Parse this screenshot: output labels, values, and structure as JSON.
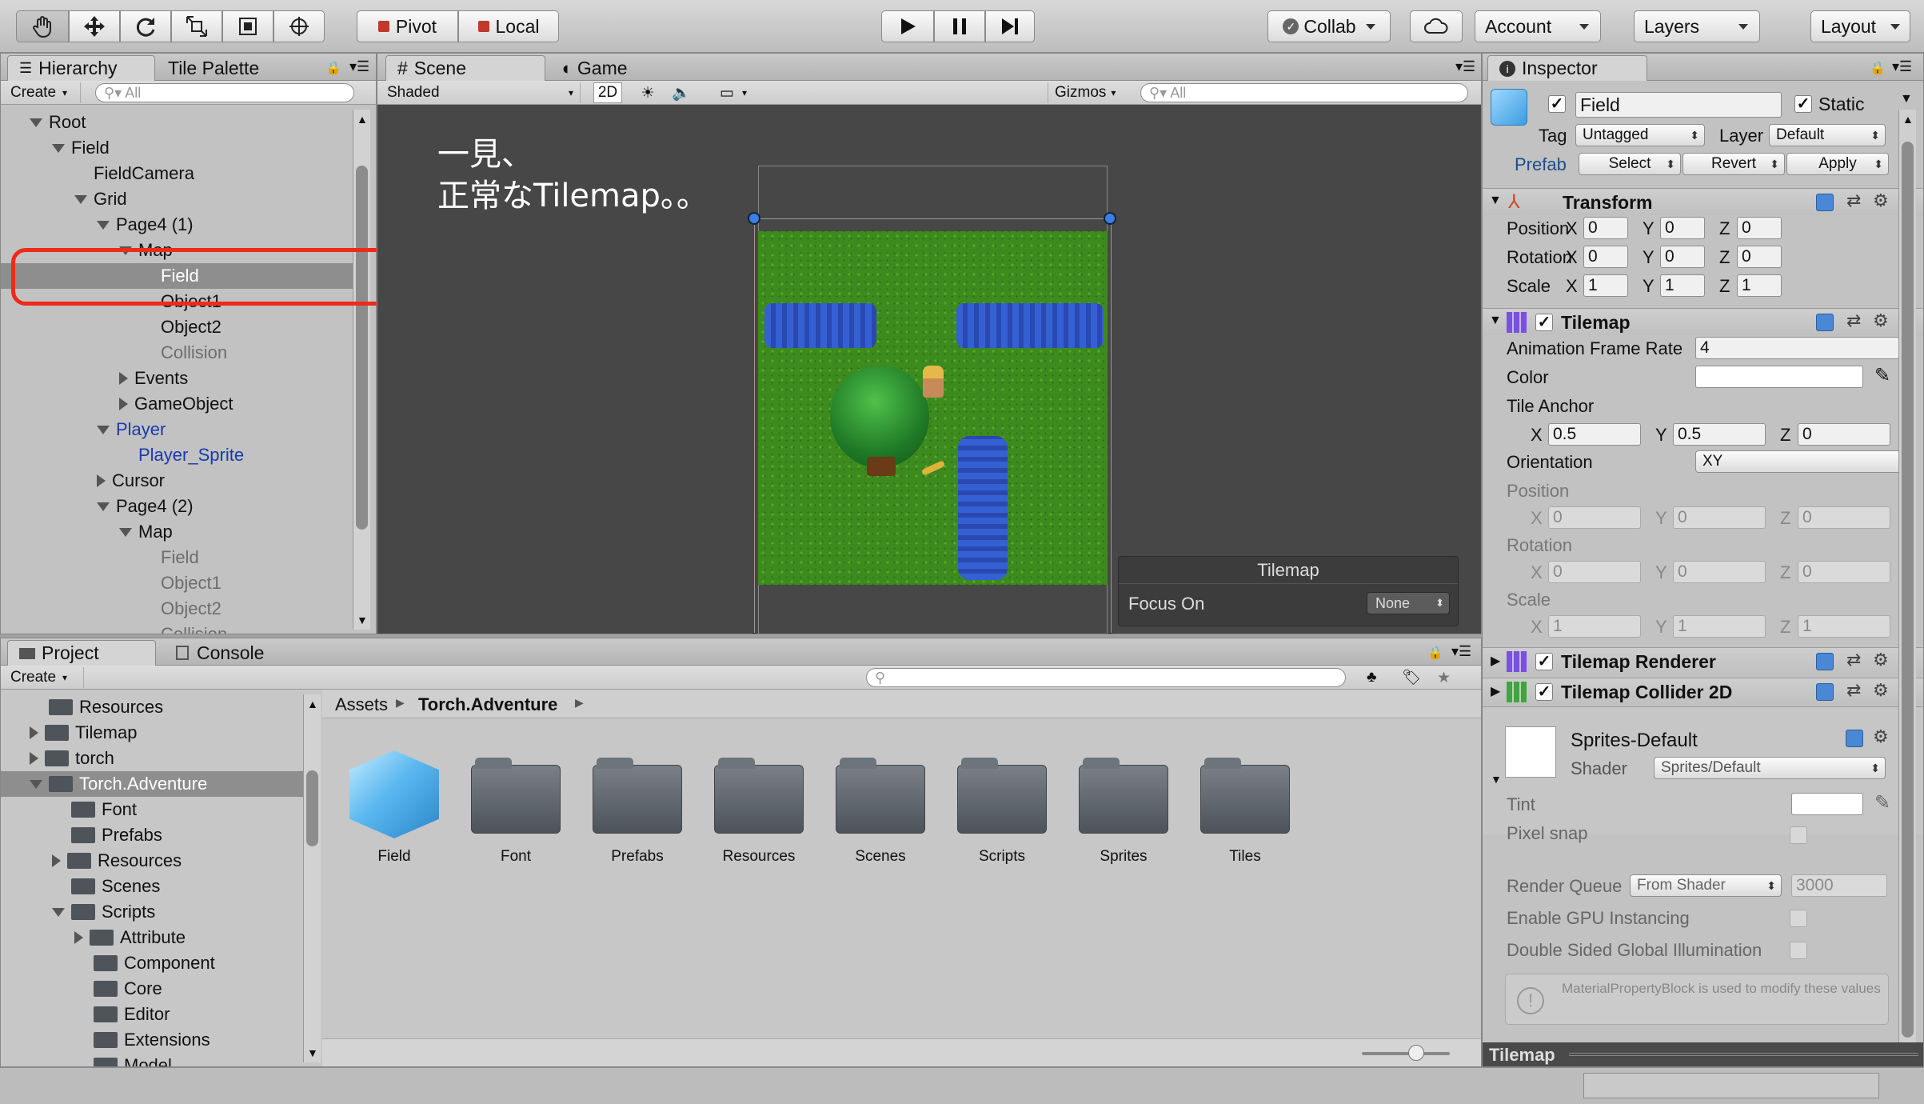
{
  "toolbar": {
    "pivot_label": "Pivot",
    "local_label": "Local",
    "collab_label": "Collab",
    "account_label": "Account",
    "layers_label": "Layers",
    "layout_label": "Layout"
  },
  "hierarchy": {
    "tab_hierarchy": "Hierarchy",
    "tab_tile_palette": "Tile Palette",
    "create_label": "Create",
    "search_placeholder": "All",
    "rows": [
      {
        "label": "Root",
        "depth": 0,
        "arrow": "down",
        "style": "normal"
      },
      {
        "label": "Field",
        "depth": 1,
        "arrow": "down",
        "style": "normal"
      },
      {
        "label": "FieldCamera",
        "depth": 2,
        "arrow": "none",
        "style": "normal"
      },
      {
        "label": "Grid",
        "depth": 2,
        "arrow": "down",
        "style": "normal"
      },
      {
        "label": "Page4 (1)",
        "depth": 3,
        "arrow": "down",
        "style": "normal"
      },
      {
        "label": "Map",
        "depth": 4,
        "arrow": "down",
        "style": "normal"
      },
      {
        "label": "Field",
        "depth": 5,
        "arrow": "none",
        "style": "selected"
      },
      {
        "label": "Object1",
        "depth": 5,
        "arrow": "none",
        "style": "normal"
      },
      {
        "label": "Object2",
        "depth": 5,
        "arrow": "none",
        "style": "normal"
      },
      {
        "label": "Collision",
        "depth": 5,
        "arrow": "none",
        "style": "grey"
      },
      {
        "label": "Events",
        "depth": 4,
        "arrow": "right",
        "style": "normal"
      },
      {
        "label": "GameObject",
        "depth": 4,
        "arrow": "right",
        "style": "normal"
      },
      {
        "label": "Player",
        "depth": 3,
        "arrow": "down",
        "style": "blue"
      },
      {
        "label": "Player_Sprite",
        "depth": 4,
        "arrow": "none",
        "style": "blue"
      },
      {
        "label": "Cursor",
        "depth": 3,
        "arrow": "right",
        "style": "normal"
      },
      {
        "label": "Page4 (2)",
        "depth": 3,
        "arrow": "down",
        "style": "normal"
      },
      {
        "label": "Map",
        "depth": 4,
        "arrow": "down",
        "style": "normal"
      },
      {
        "label": "Field",
        "depth": 5,
        "arrow": "none",
        "style": "grey"
      },
      {
        "label": "Object1",
        "depth": 5,
        "arrow": "none",
        "style": "grey"
      },
      {
        "label": "Object2",
        "depth": 5,
        "arrow": "none",
        "style": "grey"
      },
      {
        "label": "Collision",
        "depth": 5,
        "arrow": "none",
        "style": "grey"
      }
    ]
  },
  "scene": {
    "tab_scene": "Scene",
    "tab_game": "Game",
    "shaded_label": "Shaded",
    "mode_2d": "2D",
    "gizmos_label": "Gizmos",
    "search_placeholder": "All",
    "annotation_line1": "一見、",
    "annotation_line2": "正常なTilemap。。",
    "overlay_title": "Tilemap",
    "overlay_focus_label": "Focus On",
    "overlay_focus_value": "None"
  },
  "project": {
    "tab_project": "Project",
    "tab_console": "Console",
    "create_label": "Create",
    "folders": [
      {
        "label": "Resources",
        "depth": 1,
        "arrow": "none",
        "selected": false
      },
      {
        "label": "Tilemap",
        "depth": 1,
        "arrow": "right",
        "selected": false
      },
      {
        "label": "torch",
        "depth": 1,
        "arrow": "right",
        "selected": false
      },
      {
        "label": "Torch.Adventure",
        "depth": 1,
        "arrow": "down",
        "selected": true
      },
      {
        "label": "Font",
        "depth": 2,
        "arrow": "none",
        "selected": false
      },
      {
        "label": "Prefabs",
        "depth": 2,
        "arrow": "none",
        "selected": false
      },
      {
        "label": "Resources",
        "depth": 2,
        "arrow": "right",
        "selected": false
      },
      {
        "label": "Scenes",
        "depth": 2,
        "arrow": "none",
        "selected": false
      },
      {
        "label": "Scripts",
        "depth": 2,
        "arrow": "down",
        "selected": false
      },
      {
        "label": "Attribute",
        "depth": 3,
        "arrow": "right",
        "selected": false
      },
      {
        "label": "Component",
        "depth": 3,
        "arrow": "none",
        "selected": false
      },
      {
        "label": "Core",
        "depth": 3,
        "arrow": "none",
        "selected": false
      },
      {
        "label": "Editor",
        "depth": 3,
        "arrow": "none",
        "selected": false
      },
      {
        "label": "Extensions",
        "depth": 3,
        "arrow": "none",
        "selected": false
      },
      {
        "label": "Model",
        "depth": 3,
        "arrow": "none",
        "selected": false
      }
    ],
    "breadcrumb": [
      "Assets",
      "Torch.Adventure"
    ],
    "assets": [
      {
        "label": "Field",
        "kind": "prefab"
      },
      {
        "label": "Font",
        "kind": "folder"
      },
      {
        "label": "Prefabs",
        "kind": "folder"
      },
      {
        "label": "Resources",
        "kind": "folder"
      },
      {
        "label": "Scenes",
        "kind": "folder"
      },
      {
        "label": "Scripts",
        "kind": "folder"
      },
      {
        "label": "Sprites",
        "kind": "folder"
      },
      {
        "label": "Tiles",
        "kind": "folder"
      }
    ]
  },
  "inspector": {
    "tab_label": "Inspector",
    "object_name": "Field",
    "static_label": "Static",
    "tag_label": "Tag",
    "tag_value": "Untagged",
    "layer_label": "Layer",
    "layer_value": "Default",
    "prefab_label": "Prefab",
    "prefab_select": "Select",
    "prefab_revert": "Revert",
    "prefab_apply": "Apply",
    "transform": {
      "title": "Transform",
      "position_label": "Position",
      "rotation_label": "Rotation",
      "scale_label": "Scale",
      "position": [
        "0",
        "0",
        "0"
      ],
      "rotation": [
        "0",
        "0",
        "0"
      ],
      "scale": [
        "1",
        "1",
        "1"
      ]
    },
    "tilemap": {
      "title": "Tilemap",
      "anim_rate_label": "Animation Frame Rate",
      "anim_rate_value": "4",
      "color_label": "Color",
      "tile_anchor_label": "Tile Anchor",
      "tile_anchor": [
        "0.5",
        "0.5",
        "0"
      ],
      "orientation_label": "Orientation",
      "orientation_value": "XY",
      "position_label": "Position",
      "position": [
        "0",
        "0",
        "0"
      ],
      "rotation_label": "Rotation",
      "rotation": [
        "0",
        "0",
        "0"
      ],
      "scale_label": "Scale",
      "scale": [
        "1",
        "1",
        "1"
      ]
    },
    "tilemap_renderer_title": "Tilemap Renderer",
    "tilemap_collider_title": "Tilemap Collider 2D",
    "material": {
      "name": "Sprites-Default",
      "shader_label": "Shader",
      "shader_value": "Sprites/Default",
      "tint_label": "Tint",
      "pixel_snap_label": "Pixel snap",
      "render_queue_label": "Render Queue",
      "render_queue_mode": "From Shader",
      "render_queue_value": "3000",
      "gpu_label": "Enable GPU Instancing",
      "dsgi_label": "Double Sided Global Illumination",
      "info_text": "MaterialPropertyBlock is used to modify these values"
    },
    "footer_label": "Tilemap"
  },
  "axes": {
    "x": "X",
    "y": "Y",
    "z": "Z"
  }
}
